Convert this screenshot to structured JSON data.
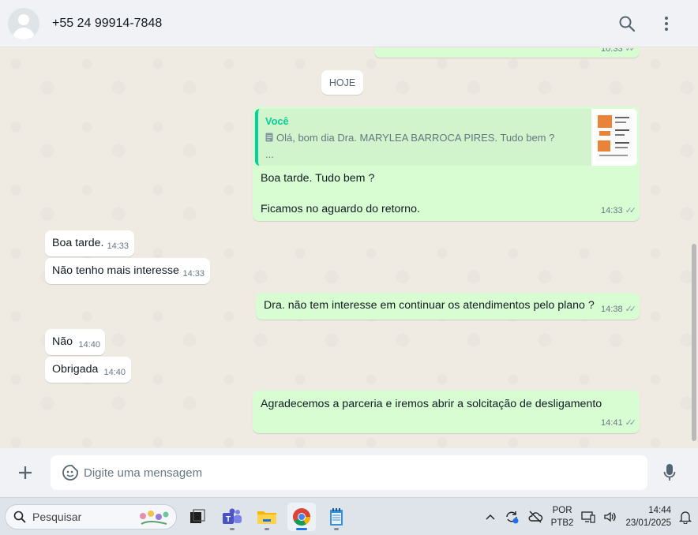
{
  "header": {
    "contact": "+55 24 99914-7848"
  },
  "chat": {
    "date_chip": "HOJE",
    "top_partial": {
      "time": "10:33"
    },
    "quoted_message": {
      "author": "Você",
      "text": "Olá, bom dia Dra. MARYLEA BARROCA PIRES. Tudo bem ?",
      "ellipsis": "...",
      "reply_line1": "Boa tarde. Tudo bem ?",
      "reply_line2": "Ficamos no aguardo do retorno.",
      "time": "14:33"
    },
    "messages": [
      {
        "text": "Boa tarde.",
        "time": "14:33"
      },
      {
        "text": "Não tenho mais interesse",
        "time": "14:33"
      },
      {
        "text": "Dra. não tem interesse em continuar os atendimentos pelo plano ?",
        "time": "14:38"
      },
      {
        "text": "Não",
        "time": "14:40"
      },
      {
        "text": "Obrigada",
        "time": "14:40"
      },
      {
        "text": "Agradecemos a parceria e iremos abrir a solcitação de desligamento",
        "time": "14:41"
      }
    ]
  },
  "composer": {
    "placeholder": "Digite uma mensagem"
  },
  "taskbar": {
    "search_label": "Pesquisar",
    "language": "POR",
    "layout": "PTB2",
    "time": "14:44",
    "date": "23/01/2025"
  },
  "colors": {
    "outgoing_bubble": "#d9fdd3",
    "incoming_bubble": "#ffffff",
    "quote_accent": "#06cf9c",
    "chat_background": "#efeae2"
  }
}
